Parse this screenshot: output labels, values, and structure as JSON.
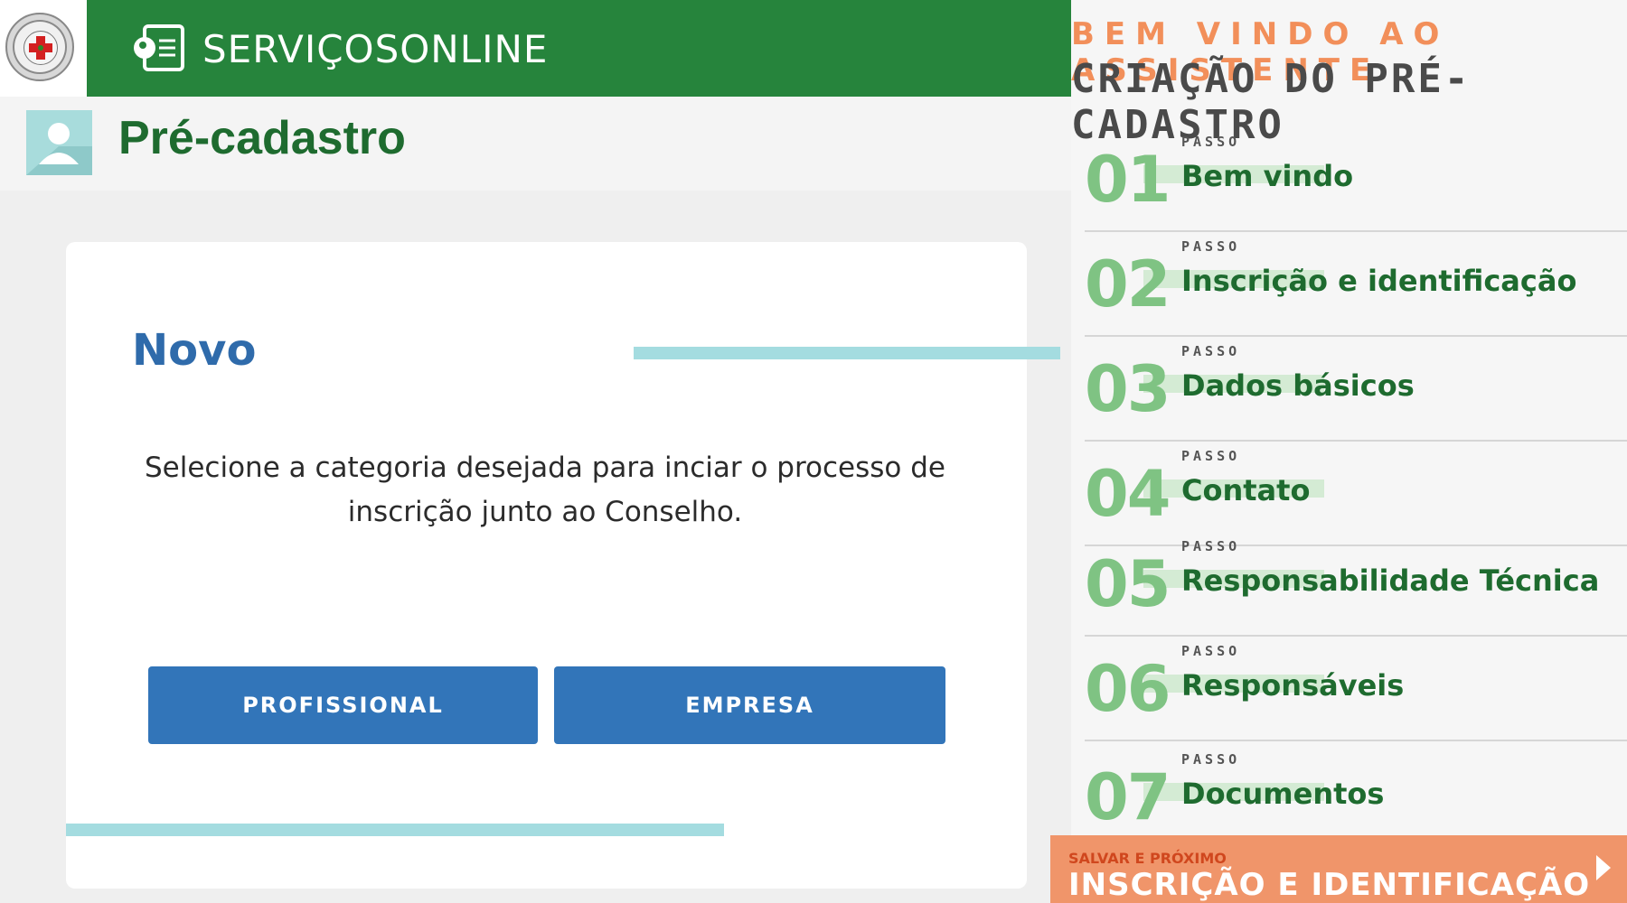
{
  "header": {
    "brand_title": "SERVIÇOSONLINE"
  },
  "page": {
    "title": "Pré-cadastro"
  },
  "card": {
    "heading": "Novo",
    "description_line1": "Selecione a categoria desejada para inciar o processo de",
    "description_line2": "inscrição junto ao Conselho.",
    "buttons": {
      "profissional": "PROFISSIONAL",
      "empresa": "EMPRESA"
    }
  },
  "wizard": {
    "welcome": "BEM VINDO AO ASSISTENTE",
    "heading": "CRIAÇÃO DO PRÉ-CADASTRO",
    "steps": [
      {
        "number": "01",
        "small": "PASSO",
        "label": "Bem vindo"
      },
      {
        "number": "02",
        "small": "PASSO",
        "label": "Inscrição e identificação"
      },
      {
        "number": "03",
        "small": "PASSO",
        "label": "Dados básicos"
      },
      {
        "number": "04",
        "small": "PASSO",
        "label": "Contato"
      },
      {
        "number": "05",
        "small": "PASSO",
        "label": "Responsabilidade Técnica"
      },
      {
        "number": "06",
        "small": "PASSO",
        "label": "Responsáveis"
      },
      {
        "number": "07",
        "small": "PASSO",
        "label": "Documentos"
      }
    ],
    "save_next": {
      "small": "SALVAR E PRÓXIMO",
      "big": "INSCRIÇÃO E IDENTIFICAÇÃO"
    }
  },
  "colors": {
    "header_green": "#26843c",
    "title_green": "#1e6b2f",
    "button_blue": "#3275b9",
    "accent_orange": "#f28f5a",
    "step_number_green": "#7fc383",
    "divider_teal": "#a4dce0"
  },
  "icons": {
    "logo": "council-seal-icon",
    "services": "id-card-icon",
    "avatar": "user-avatar-icon",
    "next": "chevron-right-icon"
  }
}
